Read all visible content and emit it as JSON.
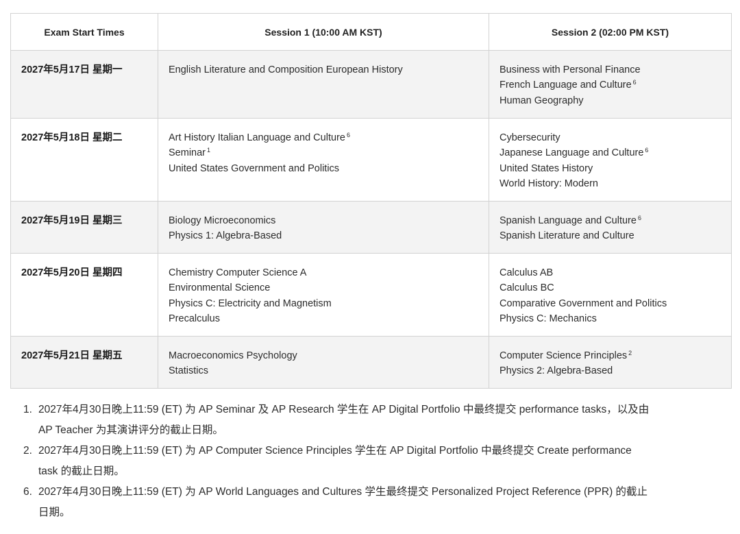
{
  "table": {
    "headers": [
      "Exam Start Times",
      "Session 1 (10:00 AM KST)",
      "Session 2 (02:00 PM KST)"
    ],
    "rows": [
      {
        "date": "2027年5月17日 星期一",
        "session1": [
          {
            "text": "English Literature and Composition European History",
            "sup": ""
          }
        ],
        "session2": [
          {
            "text": "Business with Personal Finance",
            "sup": ""
          },
          {
            "text": "French Language and Culture",
            "sup": "6"
          },
          {
            "text": "Human Geography",
            "sup": ""
          }
        ]
      },
      {
        "date": "2027年5月18日 星期二",
        "session1": [
          {
            "text": "Art History Italian Language and Culture",
            "sup": "6"
          },
          {
            "text": "Seminar",
            "sup": "1"
          },
          {
            "text": "United States Government and Politics",
            "sup": ""
          }
        ],
        "session2": [
          {
            "text": "Cybersecurity",
            "sup": ""
          },
          {
            "text": "Japanese Language and Culture",
            "sup": "6"
          },
          {
            "text": "United States History",
            "sup": ""
          },
          {
            "text": "World History: Modern",
            "sup": ""
          }
        ]
      },
      {
        "date": "2027年5月19日 星期三",
        "session1": [
          {
            "text": "Biology Microeconomics",
            "sup": ""
          },
          {
            "text": "Physics 1: Algebra-Based",
            "sup": ""
          }
        ],
        "session2": [
          {
            "text": "Spanish Language and Culture",
            "sup": "6"
          },
          {
            "text": "Spanish Literature and Culture",
            "sup": ""
          }
        ]
      },
      {
        "date": "2027年5月20日 星期四",
        "session1": [
          {
            "text": "Chemistry Computer Science A",
            "sup": ""
          },
          {
            "text": "Environmental Science",
            "sup": ""
          },
          {
            "text": "Physics C: Electricity and Magnetism",
            "sup": ""
          },
          {
            "text": "Precalculus",
            "sup": ""
          }
        ],
        "session2": [
          {
            "text": "Calculus AB",
            "sup": ""
          },
          {
            "text": "Calculus BC",
            "sup": ""
          },
          {
            "text": "Comparative Government and Politics",
            "sup": ""
          },
          {
            "text": "Physics C: Mechanics",
            "sup": ""
          }
        ]
      },
      {
        "date": "2027年5月21日 星期五",
        "session1": [
          {
            "text": "Macroeconomics Psychology",
            "sup": ""
          },
          {
            "text": "Statistics",
            "sup": ""
          }
        ],
        "session2": [
          {
            "text": "Computer Science Principles",
            "sup": "2"
          },
          {
            "text": "Physics 2: Algebra-Based",
            "sup": ""
          }
        ]
      }
    ]
  },
  "notes": [
    {
      "num": "1.",
      "lines": [
        "2027年4月30日晚上11:59 (ET) 为 AP Seminar 及 AP Research 学生在 AP Digital Portfolio 中最终提交 performance tasks，以及由",
        "AP Teacher 为其演讲评分的截止日期。"
      ]
    },
    {
      "num": "2.",
      "lines": [
        "2027年4月30日晚上11:59 (ET) 为 AP Computer Science Principles 学生在 AP Digital Portfolio 中最终提交 Create performance",
        "task 的截止日期。"
      ]
    },
    {
      "num": "6.",
      "lines": [
        "2027年4月30日晚上11:59 (ET) 为 AP World Languages and Cultures 学生最终提交 Personalized Project Reference (PPR) 的截止",
        "日期。"
      ]
    }
  ]
}
